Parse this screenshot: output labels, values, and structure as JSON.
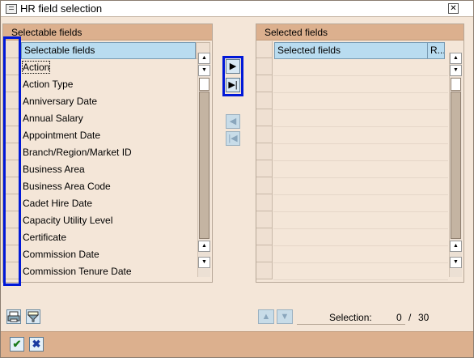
{
  "window": {
    "title": "HR field selection",
    "close_glyph": "✕"
  },
  "left_panel": {
    "heading": "Selectable fields",
    "column_header": "Selectable fields",
    "items": [
      "Action",
      "Action Type",
      "Anniversary Date",
      "Annual Salary",
      "Appointment Date",
      "Branch/Region/Market ID",
      "Business Area",
      "Business Area Code",
      "Cadet Hire Date",
      "Capacity Utility Level",
      "Certificate",
      "Commission Date",
      "Commission Tenure Date"
    ]
  },
  "right_panel": {
    "heading": "Selected fields",
    "column_header": "Selected fields",
    "column_header_2": "R..."
  },
  "move_buttons": {
    "add_one": "▶",
    "add_all": "▶|",
    "remove_one": "◀",
    "remove_all": "|◀"
  },
  "selection": {
    "label": "Selection:",
    "count": "0",
    "separator": "/",
    "total": "30"
  },
  "footer": {
    "ok_glyph": "✔",
    "cancel_glyph": "✖"
  },
  "colors": {
    "accent": "#0018d8",
    "header_bg": "#dcb08e",
    "column_header_bg": "#b9dcf0",
    "panel_bg": "#f4e6d8"
  },
  "icons": {
    "title": "window-icon",
    "print": "print-icon",
    "filter": "filter-icon",
    "ok": "checkmark-icon",
    "cancel": "cancel-icon"
  }
}
